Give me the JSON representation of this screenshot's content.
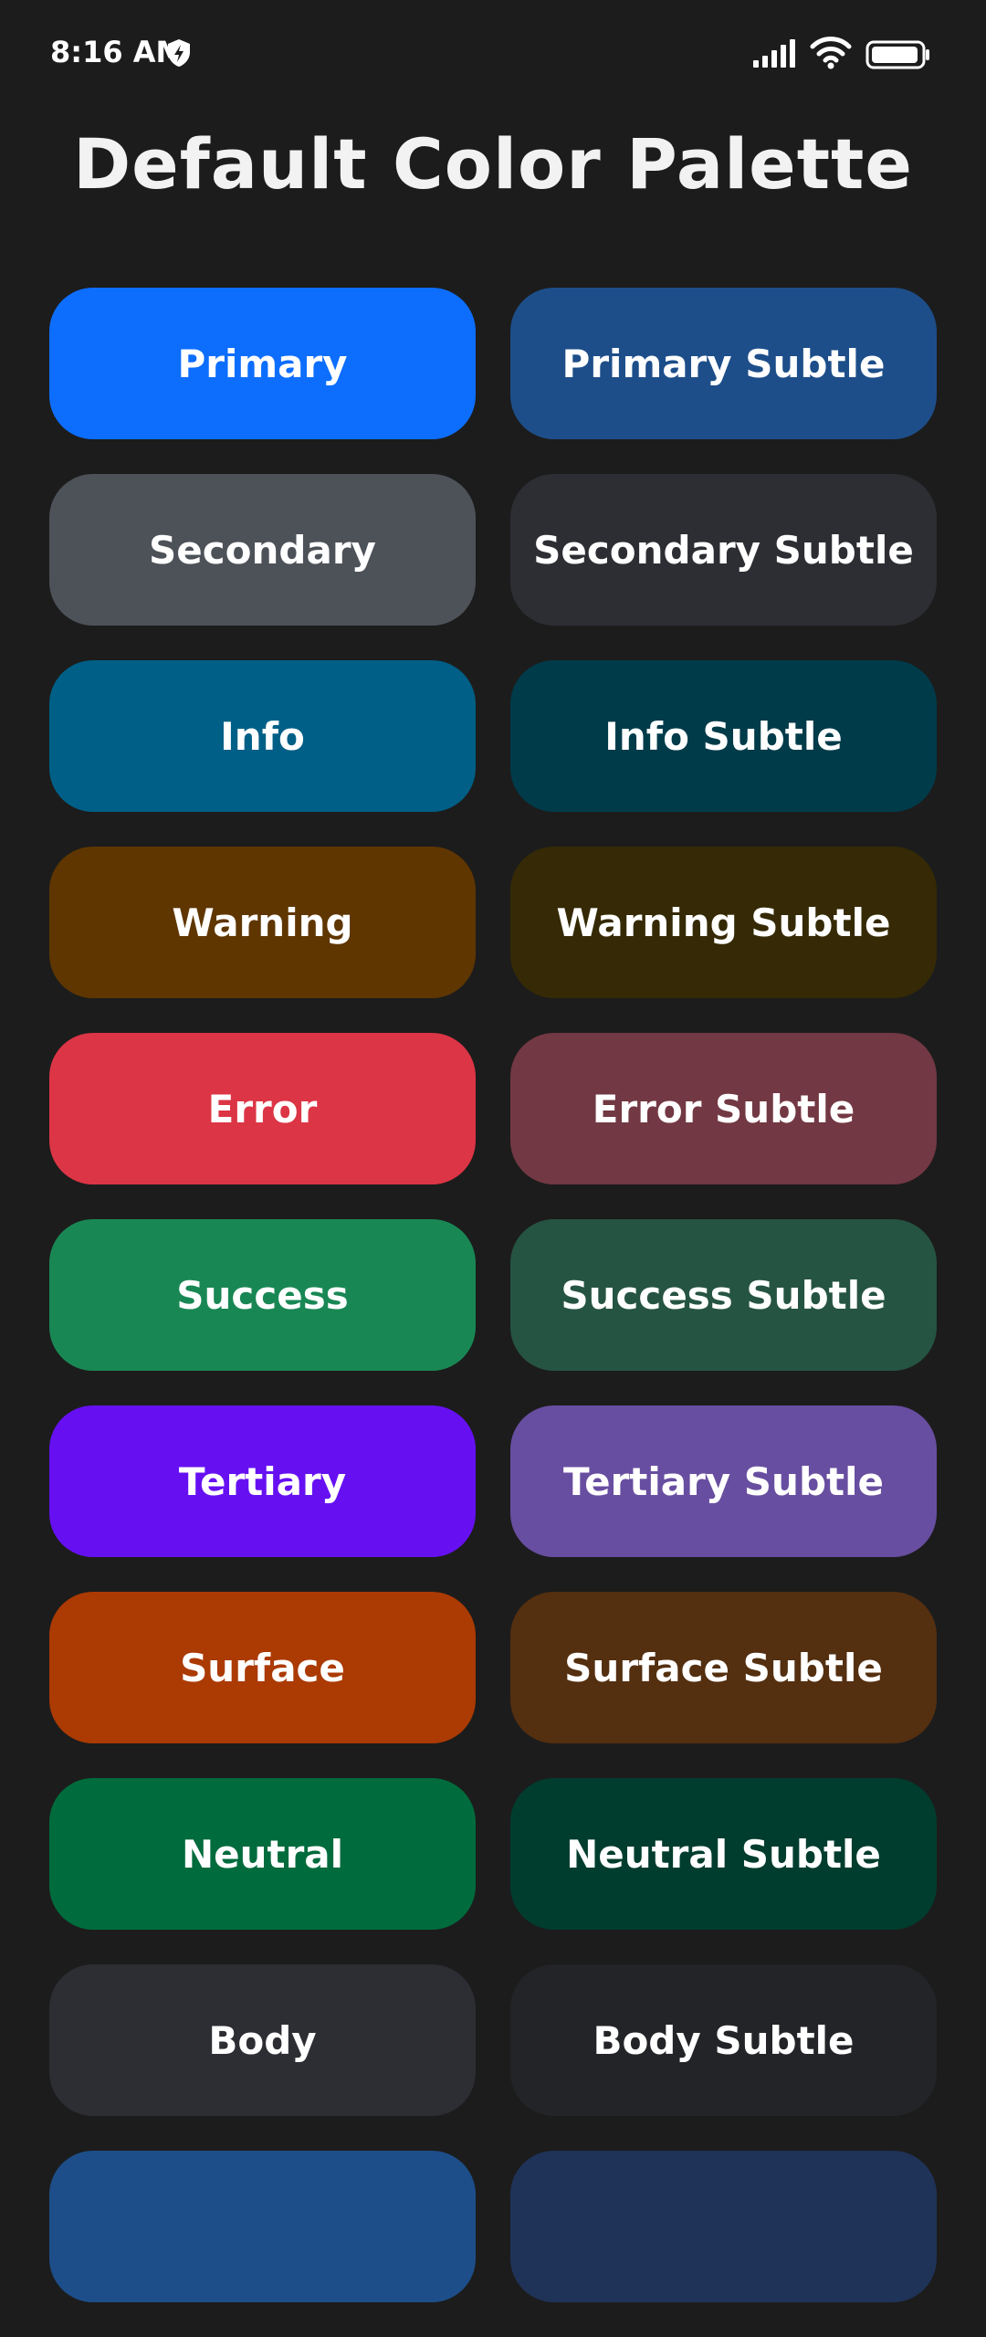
{
  "status_bar": {
    "time": "8:16 AM"
  },
  "page_title": "Default Color Palette",
  "palette": [
    {
      "main_label": "Primary",
      "main_color": "#0d6efd",
      "subtle_label": "Primary Subtle",
      "subtle_color": "#1d4e89"
    },
    {
      "main_label": "Secondary",
      "main_color": "#4d5259",
      "subtle_label": "Secondary Subtle",
      "subtle_color": "#2c2e33"
    },
    {
      "main_label": "Info",
      "main_color": "#005f86",
      "subtle_label": "Info Subtle",
      "subtle_color": "#003b4a"
    },
    {
      "main_label": "Warning",
      "main_color": "#5f3600",
      "subtle_label": "Warning Subtle",
      "subtle_color": "#352a05"
    },
    {
      "main_label": "Error",
      "main_color": "#dc3545",
      "subtle_label": "Error Subtle",
      "subtle_color": "#723843"
    },
    {
      "main_label": "Success",
      "main_color": "#198754",
      "subtle_label": "Success Subtle",
      "subtle_color": "#265442"
    },
    {
      "main_label": "Tertiary",
      "main_color": "#6610f2",
      "subtle_label": "Tertiary Subtle",
      "subtle_color": "#684ea0"
    },
    {
      "main_label": "Surface",
      "main_color": "#ab3a03",
      "subtle_label": "Surface Subtle",
      "subtle_color": "#542f10"
    },
    {
      "main_label": "Neutral",
      "main_color": "#006b3c",
      "subtle_label": "Neutral Subtle",
      "subtle_color": "#003d2e"
    },
    {
      "main_label": "Body",
      "main_color": "#2c2e33",
      "subtle_label": "Body Subtle",
      "subtle_color": "#232427"
    },
    {
      "main_label": "",
      "main_color": "#1d4e89",
      "subtle_label": "",
      "subtle_color": "#1f3358"
    }
  ]
}
